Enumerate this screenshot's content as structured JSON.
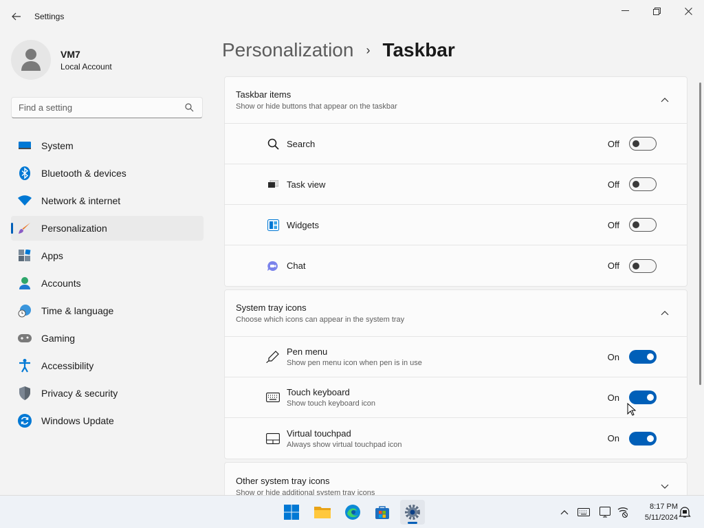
{
  "window": {
    "title": "Settings",
    "back_icon": "arrow-left-icon",
    "minimize_icon": "minimize-icon",
    "maximize_icon": "restore-icon",
    "close_icon": "close-icon"
  },
  "profile": {
    "name": "VM7",
    "account_type": "Local Account"
  },
  "search": {
    "placeholder": "Find a setting"
  },
  "nav": {
    "items": [
      {
        "label": "System",
        "icon": "monitor-icon"
      },
      {
        "label": "Bluetooth & devices",
        "icon": "bluetooth-icon"
      },
      {
        "label": "Network & internet",
        "icon": "wifi-icon"
      },
      {
        "label": "Personalization",
        "icon": "brush-icon",
        "active": true
      },
      {
        "label": "Apps",
        "icon": "apps-icon"
      },
      {
        "label": "Accounts",
        "icon": "person-icon"
      },
      {
        "label": "Time & language",
        "icon": "globe-clock-icon"
      },
      {
        "label": "Gaming",
        "icon": "gamepad-icon"
      },
      {
        "label": "Accessibility",
        "icon": "accessibility-icon"
      },
      {
        "label": "Privacy & security",
        "icon": "shield-icon"
      },
      {
        "label": "Windows Update",
        "icon": "update-icon"
      }
    ]
  },
  "breadcrumb": {
    "parent": "Personalization",
    "separator": "›",
    "current": "Taskbar"
  },
  "sections": {
    "taskbar_items": {
      "title": "Taskbar items",
      "description": "Show or hide buttons that appear on the taskbar",
      "expanded": true,
      "rows": [
        {
          "label": "Search",
          "state": "Off",
          "icon": "search-icon"
        },
        {
          "label": "Task view",
          "state": "Off",
          "icon": "task-view-icon"
        },
        {
          "label": "Widgets",
          "state": "Off",
          "icon": "widgets-icon"
        },
        {
          "label": "Chat",
          "state": "Off",
          "icon": "chat-icon"
        }
      ]
    },
    "system_tray": {
      "title": "System tray icons",
      "description": "Choose which icons can appear in the system tray",
      "expanded": true,
      "rows": [
        {
          "label": "Pen menu",
          "description": "Show pen menu icon when pen is in use",
          "state": "On",
          "icon": "pen-icon"
        },
        {
          "label": "Touch keyboard",
          "description": "Show touch keyboard icon",
          "state": "On",
          "icon": "keyboard-icon"
        },
        {
          "label": "Virtual touchpad",
          "description": "Always show virtual touchpad icon",
          "state": "On",
          "icon": "touchpad-icon"
        }
      ]
    },
    "other_tray": {
      "title": "Other system tray icons",
      "description": "Show or hide additional system tray icons",
      "expanded": false
    }
  },
  "taskbar": {
    "apps": [
      "start-icon",
      "file-explorer-icon",
      "edge-icon",
      "store-icon",
      "settings-icon"
    ],
    "tray_icons": [
      "chevron-up-icon",
      "keyboard-icon",
      "touchpad-icon",
      "network-icon",
      "notification-icon"
    ],
    "time": "8:17 PM",
    "date": "5/11/2024"
  },
  "colors": {
    "accent": "#005fb8",
    "background": "#f3f3f3",
    "card": "#fbfbfb"
  }
}
